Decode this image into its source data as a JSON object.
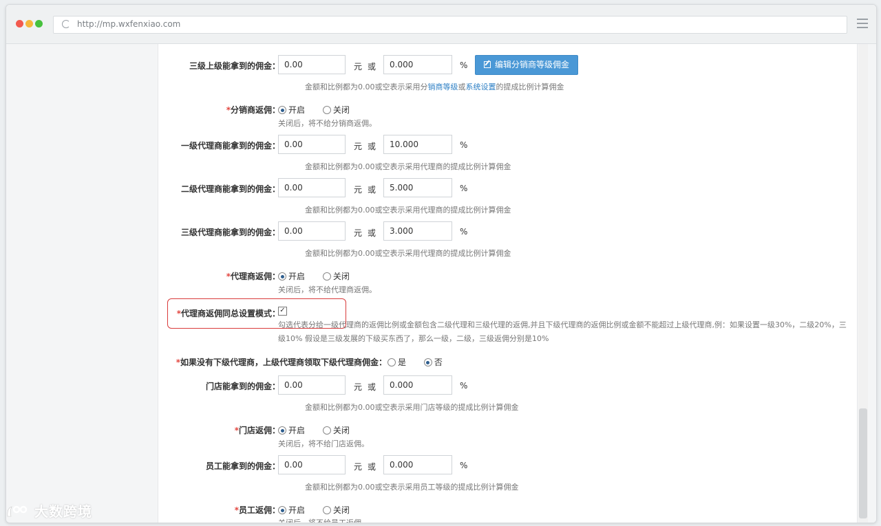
{
  "browser": {
    "url": "http://mp.wxfenxiao.com"
  },
  "units": {
    "yuan": "元",
    "or": "或",
    "percent": "%"
  },
  "tier3_upline": {
    "label": "三级上级能拿到的佣金：",
    "amount": "0.00",
    "percent": "0.000",
    "edit_button": "编辑分销商等级佣金",
    "hint_pre": "金额和比例都为0.00或空表示采用分",
    "hint_link1": "销商等级",
    "hint_mid": "或",
    "hint_link2": "系统设置",
    "hint_post": "的提成比例计算佣金"
  },
  "distributor_rebate": {
    "label": "分销商返佣：",
    "opt_on": "开启",
    "opt_off": "关闭",
    "hint": "关闭后，将不给分销商返佣。"
  },
  "agent1": {
    "label": "一级代理商能拿到的佣金：",
    "amount": "0.00",
    "percent": "10.000",
    "hint": "金额和比例都为0.00或空表示采用代理商的提成比例计算佣金"
  },
  "agent2": {
    "label": "二级代理商能拿到的佣金：",
    "amount": "0.00",
    "percent": "5.000",
    "hint": "金额和比例都为0.00或空表示采用代理商的提成比例计算佣金"
  },
  "agent3": {
    "label": "三级代理商能拿到的佣金：",
    "amount": "0.00",
    "percent": "3.000",
    "hint": "金额和比例都为0.00或空表示采用代理商的提成比例计算佣金"
  },
  "agent_rebate": {
    "label": "代理商返佣：",
    "opt_on": "开启",
    "opt_off": "关闭",
    "hint": "关闭后，将不给代理商返佣。"
  },
  "agent_total_mode": {
    "label": "代理商返佣同总设置模式：",
    "checked_glyph": "✓",
    "description": "勾选代表分给一级代理商的返佣比例或金额包含二级代理和三级代理的返佣,并且下级代理商的返佣比例或金额不能超过上级代理商,例：如果设置一级30%，二级20%，三级10% 假设是三级发展的下级买东西了，那么一级，二级，三级返佣分别是10%"
  },
  "no_subagent": {
    "label": "如果没有下级代理商，上级代理商领取下级代理商佣金：",
    "opt_yes": "是",
    "opt_no": "否"
  },
  "store": {
    "label": "门店能拿到的佣金：",
    "amount": "0.00",
    "percent": "0.000",
    "hint": "金额和比例都为0.00或空表示采用门店等级的提成比例计算佣金"
  },
  "store_rebate": {
    "label": "门店返佣：",
    "opt_on": "开启",
    "opt_off": "关闭",
    "hint": "关闭后，将不给门店返佣。"
  },
  "staff": {
    "label": "员工能拿到的佣金：",
    "amount": "0.00",
    "percent": "0.000",
    "hint": "金额和比例都为0.00或空表示采用员工等级的提成比例计算佣金"
  },
  "staff_rebate": {
    "label": "员工返佣：",
    "opt_on": "开启",
    "opt_off": "关闭",
    "hint": "关闭后，将不给员工返佣。"
  },
  "watermark": {
    "text": "大数跨境"
  }
}
